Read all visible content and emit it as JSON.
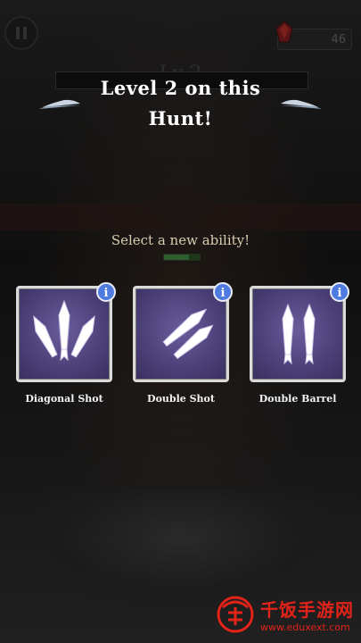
{
  "hud": {
    "gem_count": "46",
    "level_ghost": "Lv 2"
  },
  "level_up": {
    "title_line1": "Level 2 on this",
    "title_line2": "Hunt!",
    "subtitle": "Select a new ability!"
  },
  "abilities": [
    {
      "label": "Diagonal Shot",
      "icon": "diagonal-shot-icon",
      "info": "i"
    },
    {
      "label": "Double Shot",
      "icon": "double-shot-icon",
      "info": "i"
    },
    {
      "label": "Double Barrel",
      "icon": "double-barrel-icon",
      "info": "i"
    }
  ],
  "watermark": {
    "brand_cn": "千饭手游网",
    "url": "www.eduxext.com"
  },
  "colors": {
    "card_bg": "#4b3f78",
    "info_button": "#4f7be0",
    "subtitle": "#d9ccb0",
    "watermark_red": "#e2231a"
  }
}
